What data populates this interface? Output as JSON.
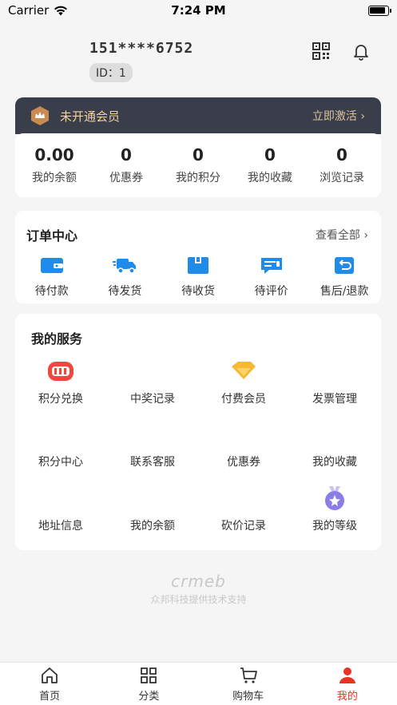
{
  "status_bar": {
    "carrier": "Carrier",
    "time": "7:24 PM",
    "battery_level": 0.9
  },
  "profile": {
    "phone": "151****6752",
    "id_label": "ID：1"
  },
  "vip": {
    "title": "未开通会员",
    "action": "立即激活"
  },
  "stats": [
    {
      "value": "0.00",
      "label": "我的余额"
    },
    {
      "value": "0",
      "label": "优惠券"
    },
    {
      "value": "0",
      "label": "我的积分"
    },
    {
      "value": "0",
      "label": "我的收藏"
    },
    {
      "value": "0",
      "label": "浏览记录"
    }
  ],
  "orders": {
    "title": "订单中心",
    "view_all": "查看全部",
    "items": [
      {
        "label": "待付款",
        "icon": "wallet-icon"
      },
      {
        "label": "待发货",
        "icon": "truck-icon"
      },
      {
        "label": "待收货",
        "icon": "box-icon"
      },
      {
        "label": "待评价",
        "icon": "review-icon"
      },
      {
        "label": "售后/退款",
        "icon": "refund-icon"
      }
    ]
  },
  "services": {
    "title": "我的服务",
    "items": [
      {
        "label": "积分兑换"
      },
      {
        "label": "中奖记录"
      },
      {
        "label": "付费会员"
      },
      {
        "label": "发票管理"
      },
      {
        "label": "积分中心"
      },
      {
        "label": "联系客服"
      },
      {
        "label": "优惠券"
      },
      {
        "label": "我的收藏"
      },
      {
        "label": "地址信息"
      },
      {
        "label": "我的余额"
      },
      {
        "label": "砍价记录"
      },
      {
        "label": "我的等级"
      }
    ]
  },
  "footer": {
    "logo": "crmeb",
    "text": "众邦科技提供技术支持"
  },
  "tabs": [
    {
      "label": "首页",
      "icon": "home-icon"
    },
    {
      "label": "分类",
      "icon": "category-icon"
    },
    {
      "label": "购物车",
      "icon": "cart-icon"
    },
    {
      "label": "我的",
      "icon": "user-icon",
      "active": true
    }
  ],
  "colors": {
    "accent": "#e93323",
    "vip_bg": "#3a3e4a",
    "vip_gold": "#f4d29c",
    "icon_blue": "#1f8ceb"
  }
}
